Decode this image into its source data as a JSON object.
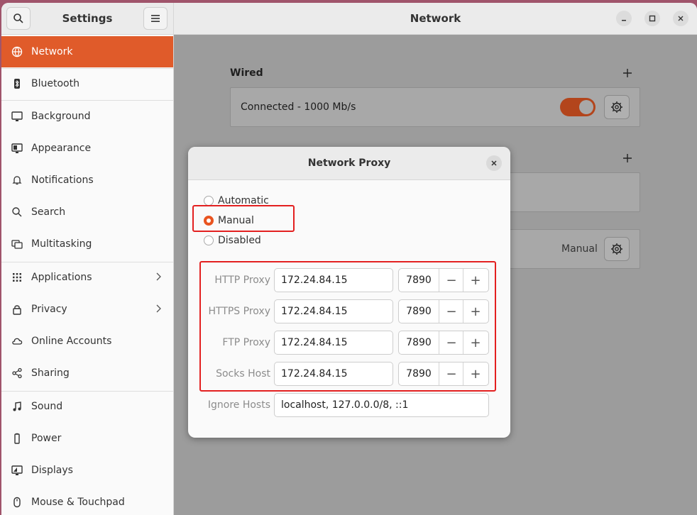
{
  "window": {
    "app_title": "Settings",
    "page_title": "Network"
  },
  "sidebar": {
    "items": [
      {
        "label": "Network",
        "icon": "globe-icon"
      },
      {
        "label": "Bluetooth",
        "icon": "bluetooth-icon"
      },
      {
        "label": "Background",
        "icon": "monitor-icon"
      },
      {
        "label": "Appearance",
        "icon": "appearance-icon"
      },
      {
        "label": "Notifications",
        "icon": "bell-icon"
      },
      {
        "label": "Search",
        "icon": "search-icon"
      },
      {
        "label": "Multitasking",
        "icon": "multitasking-icon"
      },
      {
        "label": "Applications",
        "icon": "grid-icon"
      },
      {
        "label": "Privacy",
        "icon": "lock-icon"
      },
      {
        "label": "Online Accounts",
        "icon": "cloud-icon"
      },
      {
        "label": "Sharing",
        "icon": "share-icon"
      },
      {
        "label": "Sound",
        "icon": "music-note-icon"
      },
      {
        "label": "Power",
        "icon": "power-icon"
      },
      {
        "label": "Displays",
        "icon": "display-icon"
      },
      {
        "label": "Mouse & Touchpad",
        "icon": "mouse-icon"
      }
    ]
  },
  "main": {
    "wired": {
      "label": "Wired",
      "status": "Connected - 1000 Mb/s"
    },
    "proxy_card": {
      "value": "Manual"
    }
  },
  "dialog": {
    "title": "Network Proxy",
    "modes": [
      "Automatic",
      "Manual",
      "Disabled"
    ],
    "selected_mode": "Manual",
    "proxies": [
      {
        "label": "HTTP Proxy",
        "host": "172.24.84.15",
        "port": "7890"
      },
      {
        "label": "HTTPS Proxy",
        "host": "172.24.84.15",
        "port": "7890"
      },
      {
        "label": "FTP Proxy",
        "host": "172.24.84.15",
        "port": "7890"
      },
      {
        "label": "Socks Host",
        "host": "172.24.84.15",
        "port": "7890"
      }
    ],
    "ignore_hosts": {
      "label": "Ignore Hosts",
      "value": "localhost, 127.0.0.0/8, ::1"
    }
  },
  "colors": {
    "accent": "#e95420",
    "highlight": "#e32020"
  }
}
